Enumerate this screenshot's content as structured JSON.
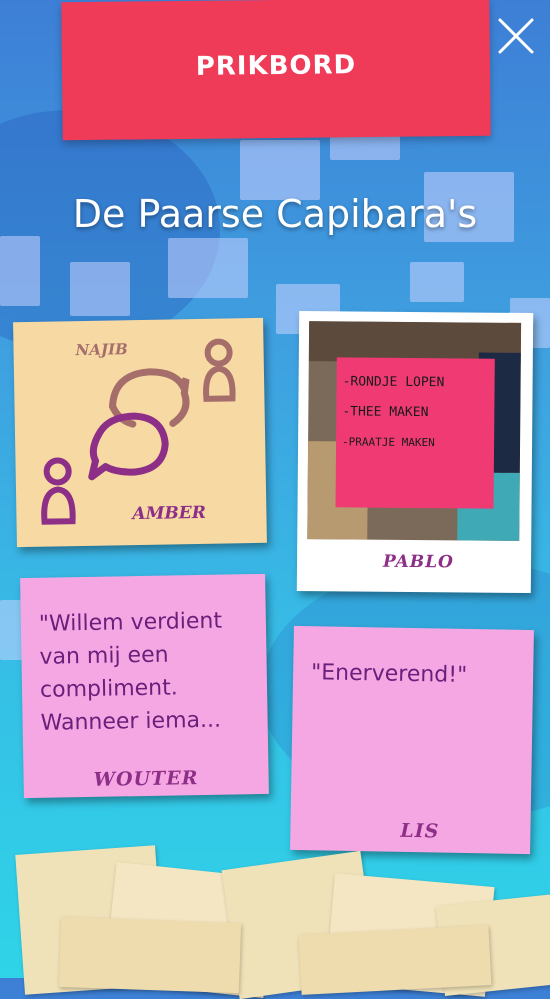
{
  "header": {
    "title": "PRIKBORD",
    "close_icon": "close-icon"
  },
  "group": {
    "name": "De Paarse Capibara's"
  },
  "icon_note": {
    "names": [
      "NAJIB",
      "AMBER"
    ],
    "icons": [
      "person-icon",
      "chat-bubbles-icon",
      "person-icon"
    ]
  },
  "photo_note": {
    "author": "PABLO",
    "sticky_lines": [
      "-RONDJE LOPEN",
      "-THEE MAKEN",
      "-PRAATJE MAKEN"
    ]
  },
  "notes": [
    {
      "text": "\"Willem verdient van mij een compliment. Wanneer iema...",
      "author": "WOUTER"
    },
    {
      "text": "\"Enerverend!\"",
      "author": "LIS"
    }
  ],
  "colors": {
    "banner": "#ef3a58",
    "sticky_yellow": "#f6d9a3",
    "sticky_pink": "#f5a7e4",
    "ink": "#8d2e87"
  }
}
